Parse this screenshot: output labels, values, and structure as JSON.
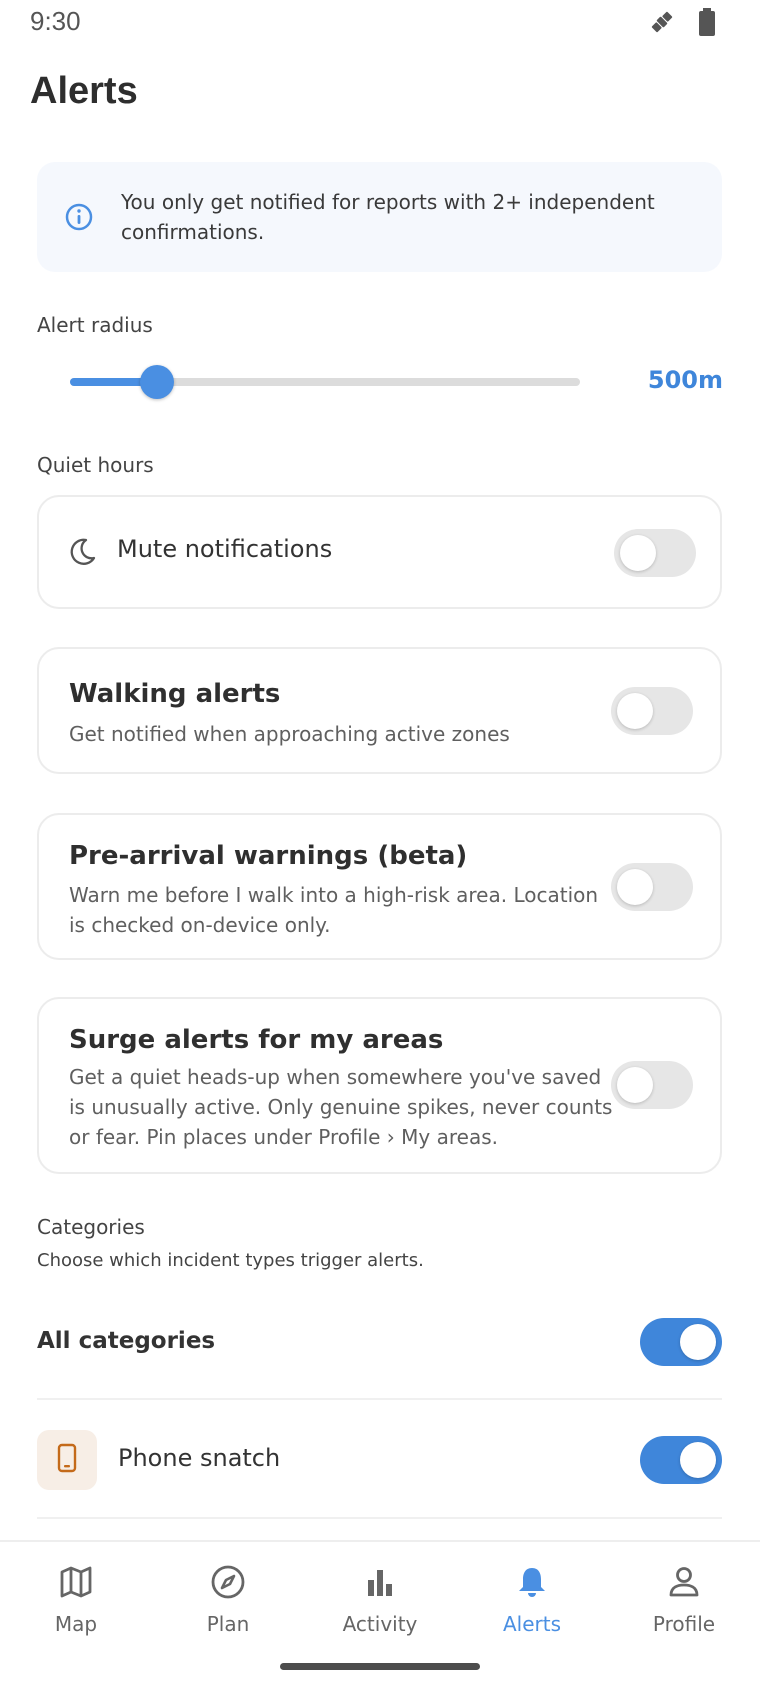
{
  "status": {
    "time": "9:30",
    "icons": [
      "satellite-icon",
      "battery-icon"
    ]
  },
  "page": {
    "title": "Alerts"
  },
  "info_banner": {
    "icon": "info-icon",
    "text": "You only get notified for reports with 2+ independent confirmations."
  },
  "alert_radius": {
    "label": "Alert radius",
    "value_label": "500m",
    "slider_fraction": 0.17
  },
  "quiet_hours": {
    "label": "Quiet hours",
    "mute_label": "Mute notifications",
    "mute_on": false,
    "icon": "moon-icon"
  },
  "settings": [
    {
      "title": "Walking alerts",
      "desc": "Get notified when approaching active zones",
      "on": false
    },
    {
      "title": "Pre-arrival warnings (beta)",
      "desc": "Warn me before I walk into a high-risk area. Location is checked on-device only.",
      "on": false
    },
    {
      "title": "Surge alerts for my areas",
      "desc": "Get a quiet heads-up when somewhere you've saved is unusually active. Only genuine spikes, never counts or fear. Pin places under Profile › My areas.",
      "on": false
    }
  ],
  "categories": {
    "label": "Categories",
    "subtitle": "Choose which incident types trigger alerts.",
    "all_label": "All categories",
    "all_on": true,
    "items": [
      {
        "label": "Phone snatch",
        "icon": "phone-icon",
        "on": true
      }
    ]
  },
  "colors": {
    "accent": "#4a8fe2",
    "banner_bg": "#f5f8fd",
    "toggle_off": "#e6e6e6"
  },
  "nav": {
    "items": [
      {
        "label": "Map",
        "icon": "map-icon"
      },
      {
        "label": "Plan",
        "icon": "compass-icon"
      },
      {
        "label": "Activity",
        "icon": "bar-chart-icon"
      },
      {
        "label": "Alerts",
        "icon": "bell-icon",
        "active": true
      },
      {
        "label": "Profile",
        "icon": "person-icon"
      }
    ]
  }
}
